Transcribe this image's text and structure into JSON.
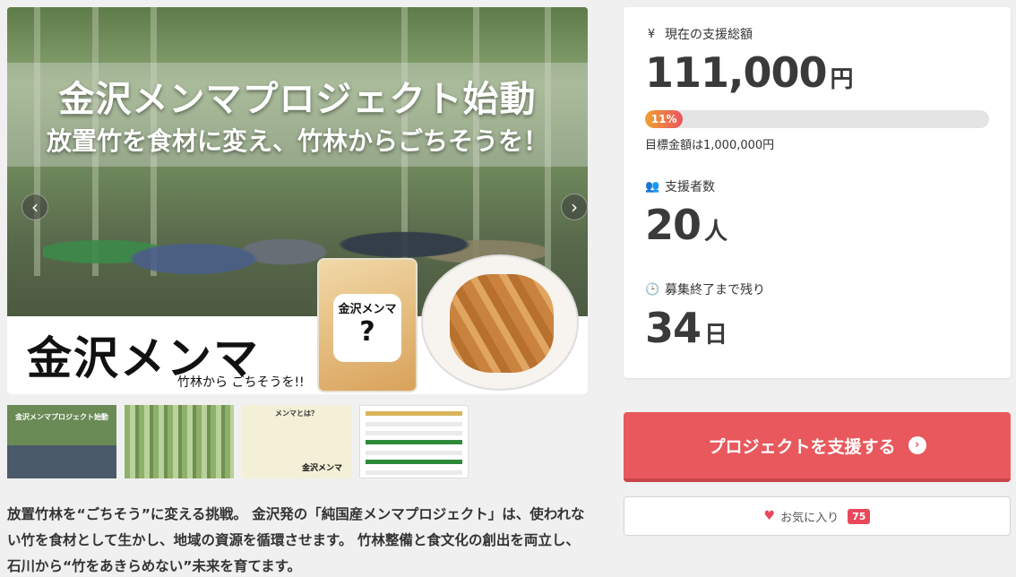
{
  "hero": {
    "title": "金沢メンマプロジェクト始動",
    "subtitle": "放置竹を食材に変え、竹林からごちそうを！",
    "logo_text": "金沢メンマ",
    "logo_sub": "竹林から ごちそうを!!",
    "package_label": "金沢メンマ",
    "package_mark": "?",
    "prev_icon": "‹",
    "next_icon": "›"
  },
  "thumbnails": [
    {
      "caption": "金沢メンマプロジェクト始動"
    },
    {
      "caption": ""
    },
    {
      "caption": "メンマとは？",
      "brand": "金沢メンマ"
    },
    {
      "caption": ""
    }
  ],
  "description": "放置竹林を“ごちそう”に変える挑戦。 金沢発の「純国産メンマプロジェクト」は、使われない竹を食材として生かし、地域の資源を循環させます。 竹林整備と食文化の創出を両立し、石川から“竹をあきらめない”未来を育てます。",
  "stats": {
    "total_label": "現在の支援総額",
    "total_icon": "¥",
    "total_amount": "111,000",
    "total_unit": "円",
    "progress_text": "11%",
    "progress_percent": 11,
    "goal_text": "目標金額は1,000,000円",
    "supporters_label": "支援者数",
    "supporters_icon": "👥",
    "supporters_count": "20",
    "supporters_unit": "人",
    "remaining_label": "募集終了まで残り",
    "remaining_icon": "🕒",
    "remaining_days": "34",
    "remaining_unit": "日"
  },
  "actions": {
    "support_label": "プロジェクトを支援する",
    "support_icon": "›",
    "favorite_label": "お気に入り",
    "favorite_icon": "♥",
    "favorite_count": "75"
  }
}
